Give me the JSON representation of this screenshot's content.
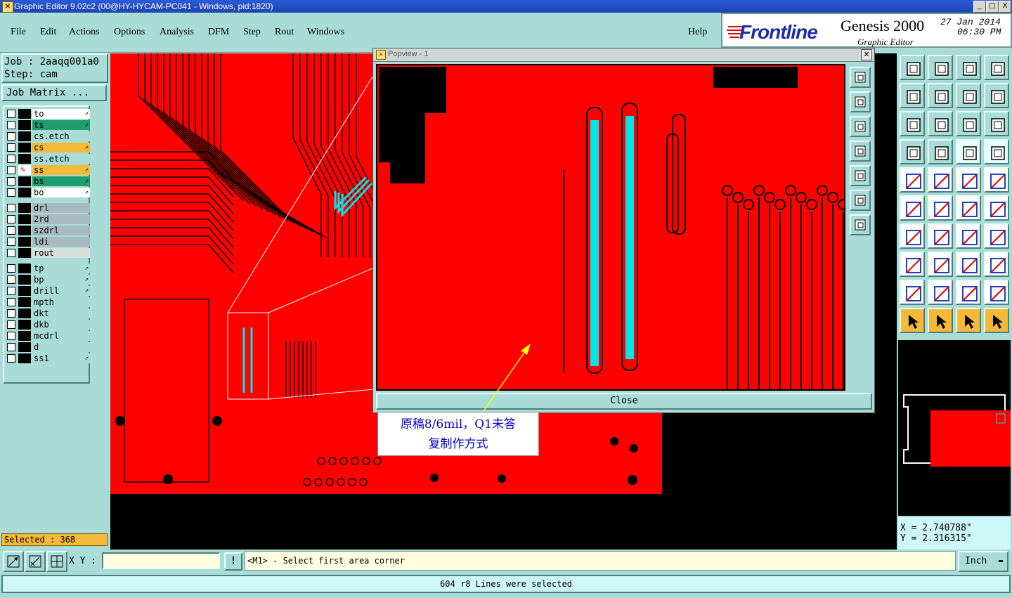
{
  "window": {
    "title": "Graphic Editor 9.02c2 (00@HY-HYCAM-PC041 - Windows, pid:1820)",
    "buttons": [
      "_",
      "□",
      "X"
    ]
  },
  "menu": [
    "File",
    "Edit",
    "Actions",
    "Options",
    "Analysis",
    "DFM",
    "Step",
    "Rout",
    "Windows"
  ],
  "help_label": "Help",
  "logo": {
    "brand": "Frontline",
    "product": "Genesis 2000",
    "subtitle": "Graphic Editor",
    "date": "27 Jan 2014",
    "time": "06:30 PM"
  },
  "job": {
    "job_label": "Job : 2aaqq001a0",
    "step_label": "Step: cam",
    "matrix_button": "Job Matrix ..."
  },
  "layers": [
    {
      "name": "to",
      "color": "#ffffff",
      "arrow": "↗"
    },
    {
      "name": "ts",
      "color": "#1e9e6e",
      "arrow": "↗"
    },
    {
      "name": "cs.etch",
      "color": "#a9dcd6",
      "arrow": ""
    },
    {
      "name": "cs",
      "color": "#f5b93a",
      "arrow": "↗"
    },
    {
      "name": "ss.etch",
      "color": "#a9dcd6",
      "arrow": ""
    },
    {
      "name": "ss",
      "color": "#f5b93a",
      "arrow": "↗"
    },
    {
      "name": "bs",
      "color": "#1e9e6e",
      "arrow": "↗"
    },
    {
      "name": "bo",
      "color": "#ffffff",
      "arrow": "↗"
    },
    {
      "name": "drl",
      "color": "#a9b9c0",
      "arrow": ""
    },
    {
      "name": "2rd",
      "color": "#a9b9c0",
      "arrow": ""
    },
    {
      "name": "szdrl",
      "color": "#a9b9c0",
      "arrow": ""
    },
    {
      "name": "ldi",
      "color": "#a9b9c0",
      "arrow": ""
    },
    {
      "name": "rout",
      "color": "#d6e0dd",
      "arrow": ""
    },
    {
      "name": "tp",
      "color": "#a9dcd6",
      "arrow": "↗"
    },
    {
      "name": "bp",
      "color": "#a9dcd6",
      "arrow": "↗"
    },
    {
      "name": "drill",
      "color": "#a9dcd6",
      "arrow": "↗"
    },
    {
      "name": "mpth",
      "color": "#a9dcd6",
      "arrow": ""
    },
    {
      "name": "dkt",
      "color": "#a9dcd6",
      "arrow": ""
    },
    {
      "name": "dkb",
      "color": "#a9dcd6",
      "arrow": ""
    },
    {
      "name": "mcdrl",
      "color": "#a9dcd6",
      "arrow": ""
    },
    {
      "name": "d",
      "color": "#a9dcd6",
      "arrow": ""
    },
    {
      "name": "ss1",
      "color": "#a9dcd6",
      "arrow": "↗"
    }
  ],
  "selected_label": "Selected : 368",
  "popview": {
    "title": "Popview - 1",
    "close_label": "Close"
  },
  "annotation": {
    "line1": "原稿8/6mil，Q1未答",
    "line2": "复制作方式"
  },
  "coords": {
    "x": "X = 2.740788\"",
    "y": "Y = 2.316315\""
  },
  "command": {
    "xy_label": "X Y :",
    "xy_value": "",
    "bang": "!",
    "prompt": "<M1> - Select first area corner",
    "units": "Inch"
  },
  "status_message": "604 r8 Lines were selected",
  "colors": {
    "panel": "#a9dcd6",
    "board": "#ff0000",
    "trace_highlight": "#00e5e5",
    "annotation_text": "#0000cc"
  }
}
